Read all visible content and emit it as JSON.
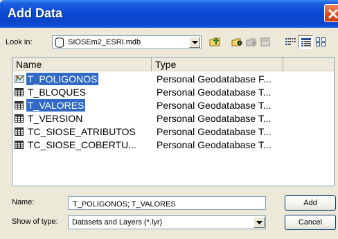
{
  "window": {
    "title": "Add Data"
  },
  "lookin": {
    "label": "Look in:",
    "value": "SIOSEm2_ESRI.mdb",
    "icon": "database-icon"
  },
  "toolbar": {
    "buttons": [
      {
        "icon": "up-folder-icon"
      },
      {
        "icon": "connect-folder-icon"
      },
      {
        "icon": "disconnect-folder-icon"
      },
      {
        "icon": "catalog-icon"
      },
      {
        "icon": "list-view-icon"
      },
      {
        "icon": "details-view-icon"
      },
      {
        "icon": "thumbnails-view-icon"
      }
    ]
  },
  "filelist": {
    "headers": {
      "name": "Name",
      "type": "Type"
    },
    "rows": [
      {
        "name": "T_POLIGONOS",
        "type": "Personal Geodatabase F...",
        "icon": "feature-class-icon",
        "selected": true
      },
      {
        "name": "T_BLOQUES",
        "type": "Personal Geodatabase T...",
        "icon": "table-icon",
        "selected": false
      },
      {
        "name": "T_VALORES",
        "type": "Personal Geodatabase T...",
        "icon": "table-icon",
        "selected": true
      },
      {
        "name": "T_VERSION",
        "type": "Personal Geodatabase T...",
        "icon": "table-icon",
        "selected": false
      },
      {
        "name": "TC_SIOSE_ATRIBUTOS",
        "type": "Personal Geodatabase T...",
        "icon": "table-icon",
        "selected": false
      },
      {
        "name": "TC_SIOSE_COBERTU...",
        "type": "Personal Geodatabase T...",
        "icon": "table-icon",
        "selected": false
      }
    ]
  },
  "form": {
    "name_label": "Name:",
    "name_value": "T_POLIGONOS; T_VALORES",
    "type_label": "Show of type:",
    "type_value": "Datasets and Layers (*.lyr)",
    "add_label": "Add",
    "cancel_label": "Cancel"
  },
  "colors": {
    "titlebar": "#0a4ad4",
    "selection": "#316ac5",
    "close": "#d94d1f"
  }
}
